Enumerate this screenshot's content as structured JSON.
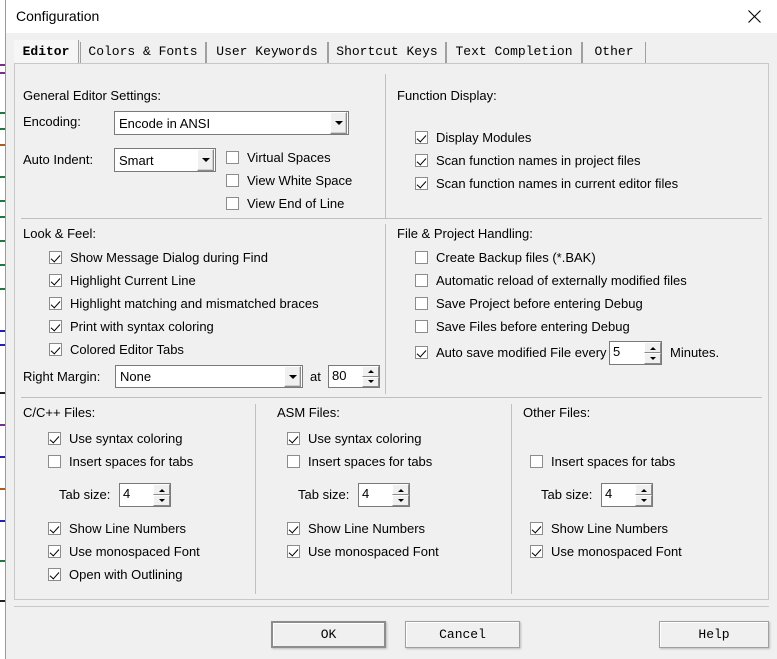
{
  "window": {
    "title": "Configuration",
    "close_icon": "close-icon"
  },
  "tabs": [
    {
      "label": "Editor",
      "selected": true
    },
    {
      "label": "Colors & Fonts",
      "selected": false
    },
    {
      "label": "User Keywords",
      "selected": false
    },
    {
      "label": "Shortcut Keys",
      "selected": false
    },
    {
      "label": "Text Completion",
      "selected": false
    },
    {
      "label": "Other",
      "selected": false
    }
  ],
  "general_editor_settings": {
    "title": "General Editor Settings:",
    "encoding_label": "Encoding:",
    "encoding_value": "Encode in ANSI",
    "auto_indent_label": "Auto Indent:",
    "auto_indent_value": "Smart",
    "checkboxes": [
      {
        "label": "Virtual Spaces",
        "checked": false
      },
      {
        "label": "View White Space",
        "checked": false
      },
      {
        "label": "View End of Line",
        "checked": false
      }
    ]
  },
  "function_display": {
    "title": "Function Display:",
    "checkboxes": [
      {
        "label": "Display Modules",
        "checked": true
      },
      {
        "label": "Scan function names in project files",
        "checked": true
      },
      {
        "label": "Scan function names in current editor files",
        "checked": true
      }
    ]
  },
  "look_and_feel": {
    "title": "Look & Feel:",
    "checkboxes": [
      {
        "label": "Show Message Dialog during Find",
        "checked": true
      },
      {
        "label": "Highlight Current Line",
        "checked": true
      },
      {
        "label": "Highlight matching and mismatched braces",
        "checked": true
      },
      {
        "label": "Print with syntax coloring",
        "checked": true
      },
      {
        "label": "Colored Editor Tabs",
        "checked": true
      }
    ],
    "right_margin_label": "Right Margin:",
    "right_margin_value": "None",
    "at_label": "at",
    "at_value": "80"
  },
  "file_project_handling": {
    "title": "File & Project Handling:",
    "checkboxes": [
      {
        "label": "Create Backup files (*.BAK)",
        "checked": false
      },
      {
        "label": "Automatic reload of externally modified files",
        "checked": false
      },
      {
        "label": "Save Project before entering Debug",
        "checked": false
      },
      {
        "label": "Save Files before entering Debug",
        "checked": false
      },
      {
        "label": "Auto save modified File every",
        "checked": true
      }
    ],
    "autosave_value": "5",
    "minutes_label": "Minutes."
  },
  "c_cpp_files": {
    "title": "C/C++ Files:",
    "use_syntax_coloring": {
      "label": "Use syntax coloring",
      "checked": true
    },
    "insert_spaces": {
      "label": "Insert spaces for tabs",
      "checked": false
    },
    "tab_size_label": "Tab size:",
    "tab_size_value": "4",
    "show_line_numbers": {
      "label": "Show Line Numbers",
      "checked": true
    },
    "use_monospaced_font": {
      "label": "Use monospaced Font",
      "checked": true
    },
    "open_with_outlining": {
      "label": "Open with Outlining",
      "checked": true
    }
  },
  "asm_files": {
    "title": "ASM Files:",
    "use_syntax_coloring": {
      "label": "Use syntax coloring",
      "checked": true
    },
    "insert_spaces": {
      "label": "Insert spaces for tabs",
      "checked": false
    },
    "tab_size_label": "Tab size:",
    "tab_size_value": "4",
    "show_line_numbers": {
      "label": "Show Line Numbers",
      "checked": true
    },
    "use_monospaced_font": {
      "label": "Use monospaced Font",
      "checked": true
    }
  },
  "other_files": {
    "title": "Other Files:",
    "insert_spaces": {
      "label": "Insert spaces for tabs",
      "checked": false
    },
    "tab_size_label": "Tab size:",
    "tab_size_value": "4",
    "show_line_numbers": {
      "label": "Show Line Numbers",
      "checked": true
    },
    "use_monospaced_font": {
      "label": "Use monospaced Font",
      "checked": true
    }
  },
  "buttons": {
    "ok": "OK",
    "cancel": "Cancel",
    "help": "Help"
  }
}
